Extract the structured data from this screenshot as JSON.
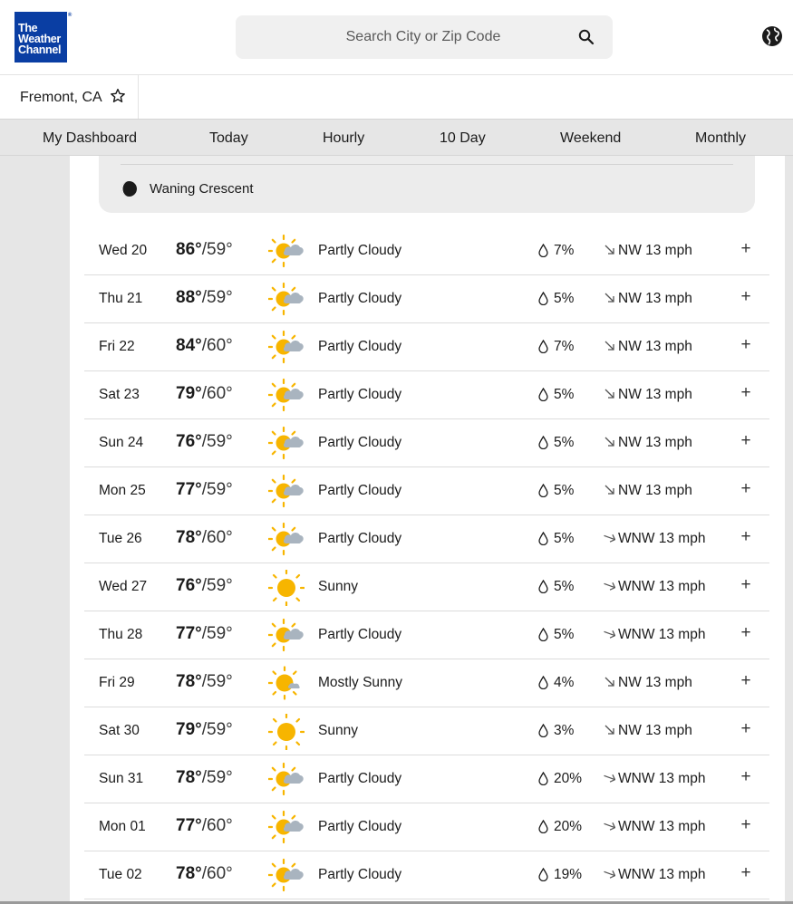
{
  "header": {
    "logo_lines": [
      "The",
      "Weather",
      "Channel"
    ],
    "search_placeholder": "Search City or Zip Code"
  },
  "location": {
    "name": "Fremont, CA"
  },
  "nav": {
    "tabs": [
      {
        "label": "My Dashboard",
        "active": false
      },
      {
        "label": "Today",
        "active": false
      },
      {
        "label": "Hourly",
        "active": false
      },
      {
        "label": "10 Day",
        "active": true
      },
      {
        "label": "Weekend",
        "active": false
      },
      {
        "label": "Monthly",
        "active": false
      }
    ]
  },
  "moon": {
    "phase": "Waning Crescent"
  },
  "forecast": [
    {
      "day": "Wed 20",
      "hi": "86°",
      "lo": "59°",
      "icon": "partly-cloudy-icon",
      "condition": "Partly Cloudy",
      "precip": "7%",
      "wind_dir": "NW",
      "wind": "NW 13 mph"
    },
    {
      "day": "Thu 21",
      "hi": "88°",
      "lo": "59°",
      "icon": "partly-cloudy-icon",
      "condition": "Partly Cloudy",
      "precip": "5%",
      "wind_dir": "NW",
      "wind": "NW 13 mph"
    },
    {
      "day": "Fri 22",
      "hi": "84°",
      "lo": "60°",
      "icon": "partly-cloudy-icon",
      "condition": "Partly Cloudy",
      "precip": "7%",
      "wind_dir": "NW",
      "wind": "NW 13 mph"
    },
    {
      "day": "Sat 23",
      "hi": "79°",
      "lo": "60°",
      "icon": "partly-cloudy-icon",
      "condition": "Partly Cloudy",
      "precip": "5%",
      "wind_dir": "NW",
      "wind": "NW 13 mph"
    },
    {
      "day": "Sun 24",
      "hi": "76°",
      "lo": "59°",
      "icon": "partly-cloudy-icon",
      "condition": "Partly Cloudy",
      "precip": "5%",
      "wind_dir": "NW",
      "wind": "NW 13 mph"
    },
    {
      "day": "Mon 25",
      "hi": "77°",
      "lo": "59°",
      "icon": "partly-cloudy-icon",
      "condition": "Partly Cloudy",
      "precip": "5%",
      "wind_dir": "NW",
      "wind": "NW 13 mph"
    },
    {
      "day": "Tue 26",
      "hi": "78°",
      "lo": "60°",
      "icon": "partly-cloudy-icon",
      "condition": "Partly Cloudy",
      "precip": "5%",
      "wind_dir": "WNW",
      "wind": "WNW 13 mph"
    },
    {
      "day": "Wed 27",
      "hi": "76°",
      "lo": "59°",
      "icon": "sunny-icon",
      "condition": "Sunny",
      "precip": "5%",
      "wind_dir": "WNW",
      "wind": "WNW 13 mph"
    },
    {
      "day": "Thu 28",
      "hi": "77°",
      "lo": "59°",
      "icon": "partly-cloudy-icon",
      "condition": "Partly Cloudy",
      "precip": "5%",
      "wind_dir": "WNW",
      "wind": "WNW 13 mph"
    },
    {
      "day": "Fri 29",
      "hi": "78°",
      "lo": "59°",
      "icon": "mostly-sunny-icon",
      "condition": "Mostly Sunny",
      "precip": "4%",
      "wind_dir": "NW",
      "wind": "NW 13 mph"
    },
    {
      "day": "Sat 30",
      "hi": "79°",
      "lo": "59°",
      "icon": "sunny-icon",
      "condition": "Sunny",
      "precip": "3%",
      "wind_dir": "NW",
      "wind": "NW 13 mph"
    },
    {
      "day": "Sun 31",
      "hi": "78°",
      "lo": "59°",
      "icon": "partly-cloudy-icon",
      "condition": "Partly Cloudy",
      "precip": "20%",
      "wind_dir": "WNW",
      "wind": "WNW 13 mph"
    },
    {
      "day": "Mon 01",
      "hi": "77°",
      "lo": "60°",
      "icon": "partly-cloudy-icon",
      "condition": "Partly Cloudy",
      "precip": "20%",
      "wind_dir": "WNW",
      "wind": "WNW 13 mph"
    },
    {
      "day": "Tue 02",
      "hi": "78°",
      "lo": "60°",
      "icon": "partly-cloudy-icon",
      "condition": "Partly Cloudy",
      "precip": "19%",
      "wind_dir": "WNW",
      "wind": "WNW 13 mph"
    }
  ],
  "colors": {
    "brand": "#0a3ea3",
    "sun": "#f7b500",
    "cloud": "#a9b4bf"
  }
}
